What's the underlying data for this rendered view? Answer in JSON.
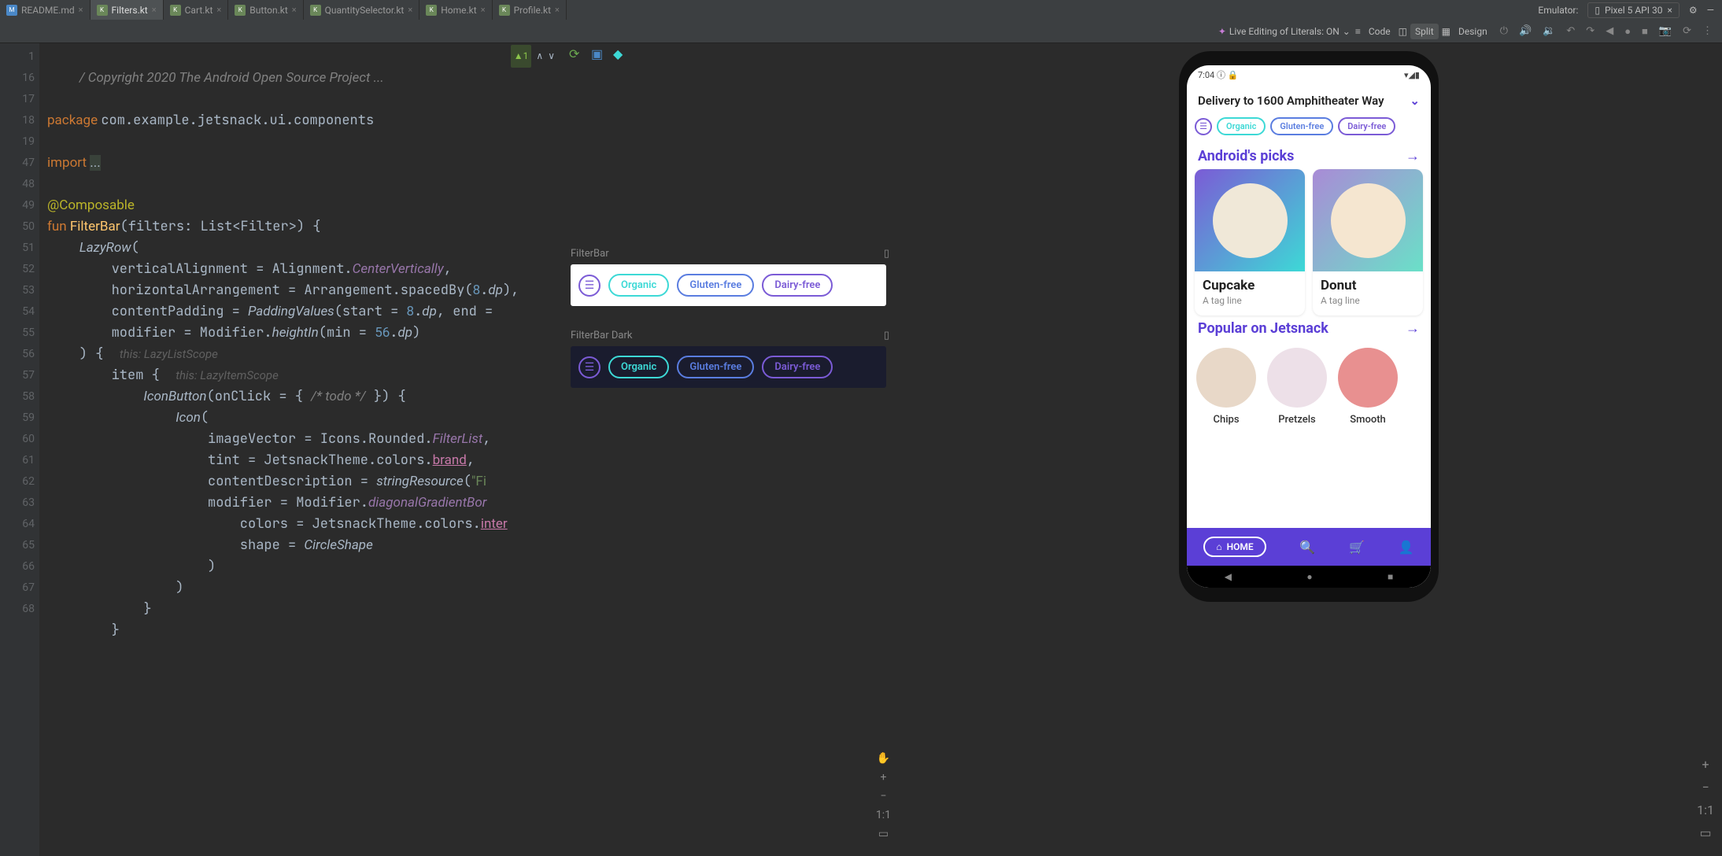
{
  "tabs": [
    {
      "name": "README.md",
      "icon": "md"
    },
    {
      "name": "Filters.kt",
      "icon": "kt",
      "active": true
    },
    {
      "name": "Cart.kt",
      "icon": "kt"
    },
    {
      "name": "Button.kt",
      "icon": "kt"
    },
    {
      "name": "QuantitySelector.kt",
      "icon": "kt"
    },
    {
      "name": "Home.kt",
      "icon": "kt"
    },
    {
      "name": "Profile.kt",
      "icon": "kt"
    }
  ],
  "top_right": {
    "emulator_label": "Emulator:",
    "device_label": "Pixel 5 API 30"
  },
  "toolbar": {
    "live_edit": "Live Editing of Literals: ON",
    "code": "Code",
    "split": "Split",
    "design": "Design"
  },
  "code": {
    "problems": "1",
    "lines": [
      "1",
      "16",
      "17",
      "18",
      "19",
      "47",
      "48",
      "49",
      "50",
      "51",
      "52",
      "53",
      "54",
      "55",
      "56",
      "57",
      "58",
      "59",
      "60",
      "61",
      "62",
      "63",
      "64",
      "65",
      "66",
      "67",
      "68"
    ]
  },
  "preview": {
    "label_light": "FilterBar",
    "label_dark": "FilterBar Dark",
    "chip1": "Organic",
    "chip2": "Gluten-free",
    "chip3": "Dairy-free"
  },
  "panel_ctrl": {
    "ratio": "1:1",
    "plus": "+",
    "minus": "−"
  },
  "emulator": {
    "time": "7:04",
    "address_label": "Delivery to 1600 Amphitheater Way",
    "chips": [
      "Organic",
      "Gluten-free",
      "Dairy-free"
    ],
    "section1": "Android's picks",
    "card1": {
      "title": "Cupcake",
      "sub": "A tag line"
    },
    "card2": {
      "title": "Donut",
      "sub": "A tag line"
    },
    "section2": "Popular on Jetsnack",
    "round": [
      "Chips",
      "Pretzels",
      "Smooth"
    ],
    "home": "HOME"
  }
}
